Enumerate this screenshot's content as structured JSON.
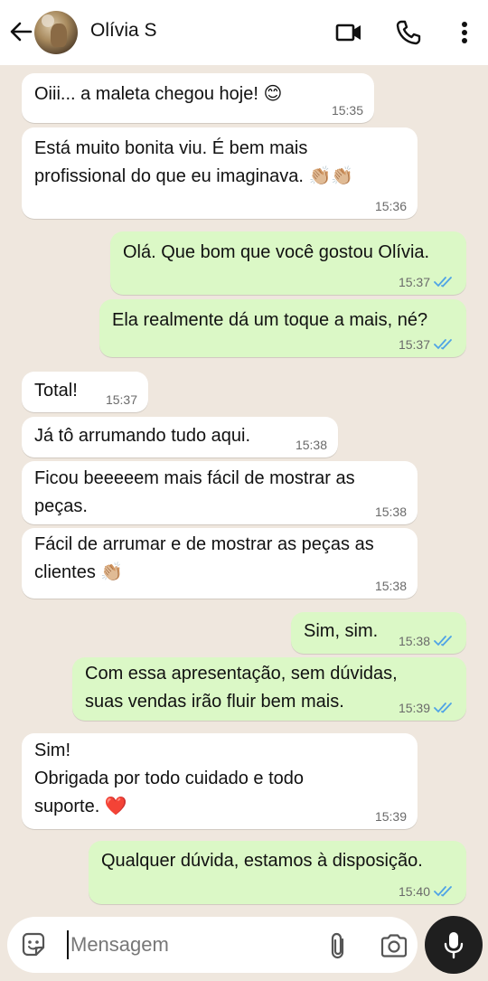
{
  "header": {
    "contact_name": "Olívia S",
    "icons": [
      "back-arrow-icon",
      "video-call-icon",
      "phone-icon",
      "more-options-icon"
    ]
  },
  "colors": {
    "incoming_bubble": "#ffffff",
    "outgoing_bubble": "#dbf8c6",
    "chat_background": "#efe7de",
    "read_ticks": "#4fa3e6"
  },
  "messages": [
    {
      "direction": "in",
      "text": "Oiii... a maleta chegou hoje! 😊",
      "time": "15:35"
    },
    {
      "direction": "in",
      "text": "Está muito bonita viu. É bem mais\nprofissional do que eu imaginava. 👏🏼👏🏼",
      "time": "15:36"
    },
    {
      "direction": "out",
      "text": "Olá. Que bom que você gostou Olívia.",
      "time": "15:37",
      "status": "read"
    },
    {
      "direction": "out",
      "text": "Ela realmente dá um toque a mais, né?",
      "time": "15:37",
      "status": "read"
    },
    {
      "direction": "in",
      "text": "Total!",
      "time": "15:37"
    },
    {
      "direction": "in",
      "text": "Já tô arrumando tudo aqui.",
      "time": "15:38"
    },
    {
      "direction": "in",
      "text": "Ficou beeeeem mais fácil de mostrar as\npeças.",
      "time": "15:38"
    },
    {
      "direction": "in",
      "text": "Fácil de arrumar e de mostrar as peças as\nclientes 👏🏼",
      "time": "15:38"
    },
    {
      "direction": "out",
      "text": "Sim, sim.",
      "time": "15:38",
      "status": "read"
    },
    {
      "direction": "out",
      "text": "Com essa apresentação, sem dúvidas,\nsuas vendas irão fluir bem mais.",
      "time": "15:39",
      "status": "read"
    },
    {
      "direction": "in",
      "text": "Sim!\nObrigada por todo cuidado e todo\nsuporte. ❤️",
      "time": "15:39"
    },
    {
      "direction": "out",
      "text": "Qualquer dúvida, estamos à disposição.",
      "time": "15:40",
      "status": "read"
    }
  ],
  "composer": {
    "placeholder": "Mensagem",
    "icons": [
      "sticker-icon",
      "attach-icon",
      "camera-icon",
      "mic-icon"
    ]
  }
}
